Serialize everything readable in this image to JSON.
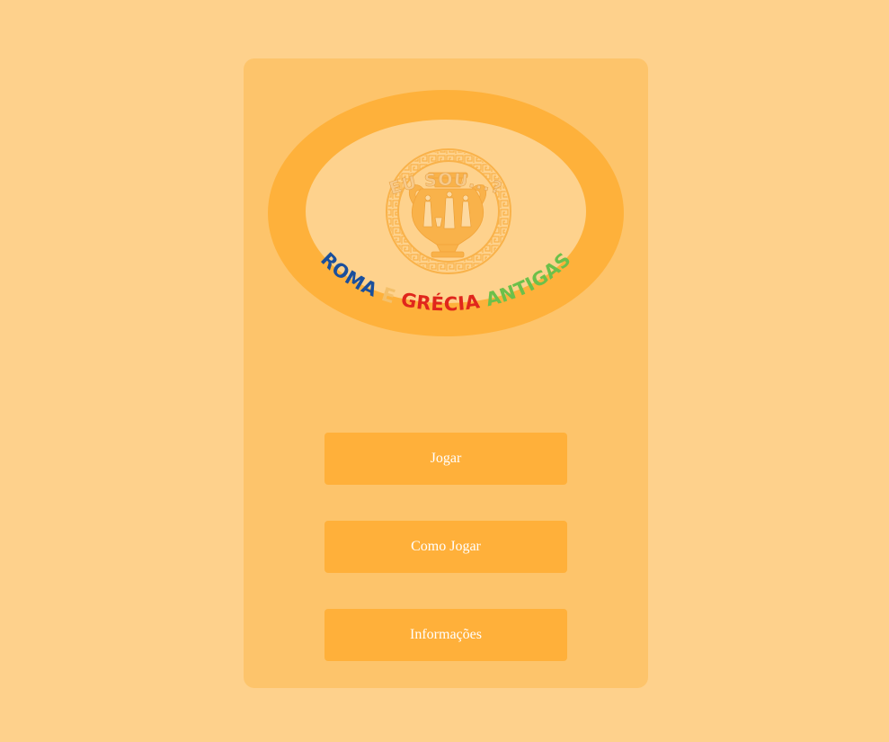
{
  "logo": {
    "top_text": "EU SOU...?",
    "bottom_words": [
      {
        "text": "ROMA",
        "color": "#1a4f9c"
      },
      {
        "text": "E",
        "color": "#f4c06a"
      },
      {
        "text": "GRÉCIA",
        "color": "#e0261c"
      },
      {
        "text": "ANTIGAS",
        "color": "#6cc04a"
      }
    ],
    "ring_color": "#feb13b",
    "inner_color": "#fed28d",
    "emblem_color": "#f9b24a"
  },
  "menu": {
    "play_label": "Jogar",
    "how_to_play_label": "Como Jogar",
    "info_label": "Informações"
  },
  "colors": {
    "page_bg": "#fed18c",
    "panel_bg": "#fdc46b",
    "button_bg": "#ffb03a",
    "button_text": "#ffffff"
  }
}
